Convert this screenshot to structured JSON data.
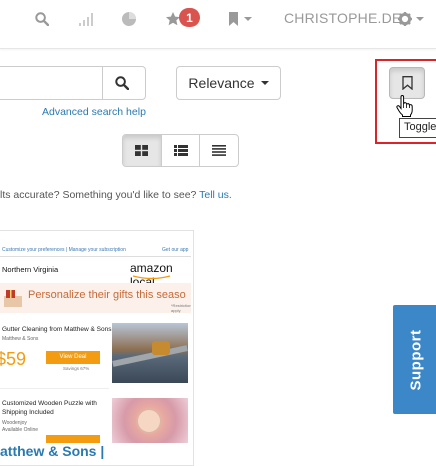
{
  "topnav": {
    "notification_count": "1",
    "user_label": "CHRISTOPHE.DE"
  },
  "search": {
    "value": "",
    "advanced_link": "Advanced search help"
  },
  "sort": {
    "label": "Relevance"
  },
  "tooltip": {
    "text": "Toggle"
  },
  "feedback": {
    "text": "lts accurate? Something you'd like to see?",
    "link": "Tell us."
  },
  "card": {
    "email_header_left": "Customize your preferences | Manage your subscription",
    "email_header_right": "Get our app",
    "region": "Northern Virginia",
    "brand": "amazon local",
    "banner": "Personalize their gifts this seaso",
    "banner_sub": "*Restrictions apply",
    "deal1_title": "Gutter Cleaning from Matthew & Sons",
    "deal1_vendor": "Matthew & Sons",
    "deal1_price": "$59",
    "deal1_button": "View Deal",
    "deal1_savings": "Savings 67%",
    "deal2_title_line1": "Customized Wooden Puzzle with",
    "deal2_title_line2": "Shipping Included",
    "deal2_vendor1": "Woodenjoy",
    "deal2_vendor2": "Available Online",
    "title": "atthew & Sons |"
  },
  "support": {
    "label": "Support"
  },
  "colors": {
    "link": "#2a7ab0",
    "badge": "#d9534f",
    "highlight": "#d9252a",
    "support": "#3b87c8",
    "deal_button": "#f39c12"
  }
}
